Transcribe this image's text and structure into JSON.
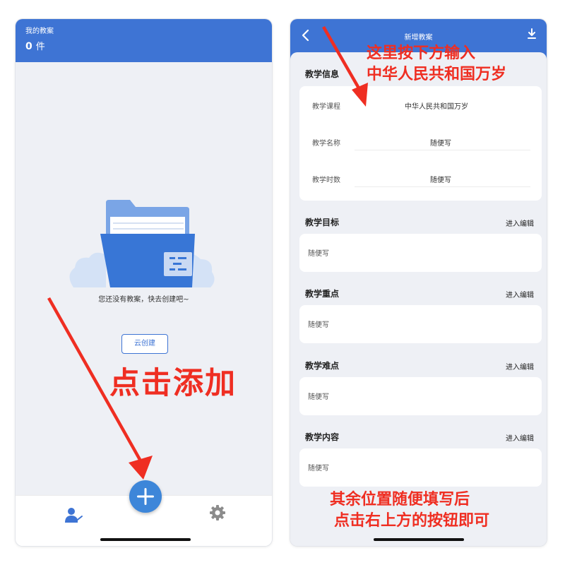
{
  "left": {
    "header_label": "我的教案",
    "count_number": "0",
    "count_unit": "件",
    "empty_message": "您还没有教案，快去创建吧~",
    "cloud_create_label": "云创建",
    "annotation": "点击添加",
    "fab_icon": "plus-icon",
    "tabs": [
      {
        "icon": "teacher-icon"
      },
      {
        "icon": "gear-icon"
      }
    ]
  },
  "right": {
    "title": "新增教案",
    "back_icon": "chevron-left-icon",
    "download_icon": "download-icon",
    "annotation_top_line1": "这里按下方输入",
    "annotation_top_line2": "中华人民共和国万岁",
    "annotation_bottom_line1": "其余位置随便填写后",
    "annotation_bottom_line2": "点击右上方的按钮即可",
    "info_title": "教学信息",
    "info_rows": [
      {
        "label": "教学课程",
        "value": "中华人民共和国万岁"
      },
      {
        "label": "教学名称",
        "value": "随便写"
      },
      {
        "label": "教学时数",
        "value": "随便写"
      }
    ],
    "sections": [
      {
        "title": "教学目标",
        "link": "进入编辑",
        "content": "随便写"
      },
      {
        "title": "教学重点",
        "link": "进入编辑",
        "content": "随便写"
      },
      {
        "title": "教学难点",
        "link": "进入编辑",
        "content": "随便写"
      },
      {
        "title": "教学内容",
        "link": "进入编辑",
        "content": "随便写"
      }
    ]
  },
  "colors": {
    "brand_blue": "#3e74d4",
    "annotation_red": "#ef2e22",
    "background": "#eef0f5"
  }
}
